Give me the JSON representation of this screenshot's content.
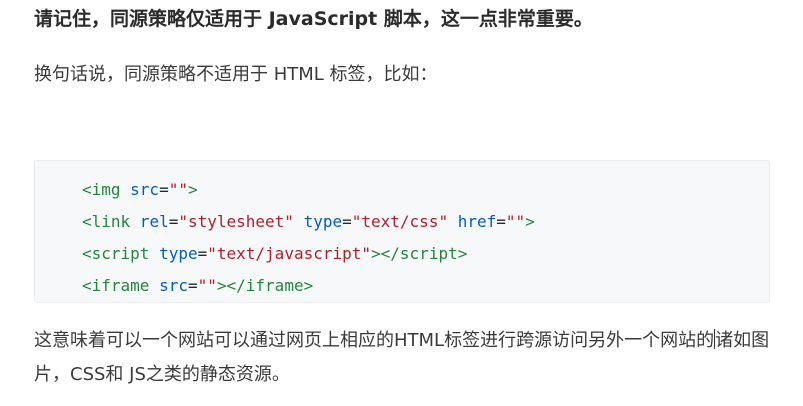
{
  "heading": "请记住，同源策略仅适用于 JavaScript 脚本，这一点非常重要。",
  "intro": "换句话说，同源策略不适用于 HTML 标签，比如：",
  "code": {
    "line1": {
      "open": "<img",
      "attr1": " src",
      "eq1": "=",
      "val1": "\"\"",
      "close": ">"
    },
    "line2": {
      "open": "<link",
      "attr1": " rel",
      "eq1": "=",
      "val1": "\"stylesheet\"",
      "attr2": " type",
      "eq2": "=",
      "val2": "\"text/css\"",
      "attr3": " href",
      "eq3": "=",
      "val3": "\"\"",
      "close": ">"
    },
    "line3": {
      "open": "<script",
      "attr1": " type",
      "eq1": "=",
      "val1": "\"text/javascript\"",
      "mid": "></",
      "endtag": "script",
      "close": ">"
    },
    "line4": {
      "open": "<iframe",
      "attr1": " src",
      "eq1": "=",
      "val1": "\"\"",
      "mid": "></",
      "endtag": "iframe",
      "close": ">"
    }
  },
  "conclusion_a": "这意味着可以一个网站可以通过网页上相应的HTML标签进行跨源访问另外一个网站的",
  "conclusion_b": "诸如图片，CSS和 JS之类的静态资源。"
}
